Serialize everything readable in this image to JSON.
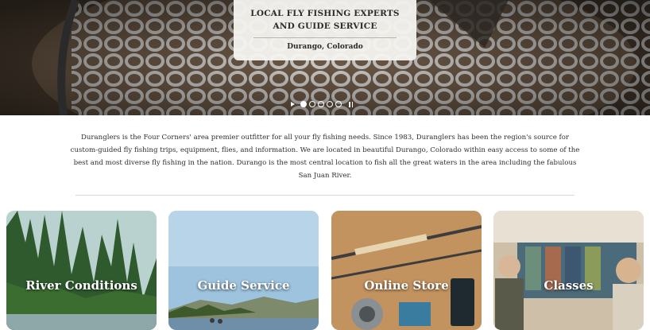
{
  "hero": {
    "title_line1": "LOCAL FLY FISHING EXPERTS",
    "title_line2": "AND GUIDE SERVICE",
    "location": "Durango, Colorado",
    "slides": 5,
    "active_slide": 1
  },
  "intro": {
    "text": "Duranglers is the Four Corners' area premier outfitter for all your fly fishing needs. Since 1983, Duranglers has been the region's source for custom-guided fly fishing trips, equipment, flies, and information. We are located in beautiful Durango, Colorado within easy access to some of the best and most diverse fly fishing in the nation. Durango is the most central location to fish all the great waters in the area including the fabulous San Juan River."
  },
  "cards": [
    {
      "label": "River Conditions"
    },
    {
      "label": "Guide Service"
    },
    {
      "label": "Online Store"
    },
    {
      "label": "Classes"
    }
  ],
  "colors": {
    "card_text": "#ffffff",
    "intro_text": "#2e2e2e",
    "hero_card_bg": "#f5f4f0"
  }
}
